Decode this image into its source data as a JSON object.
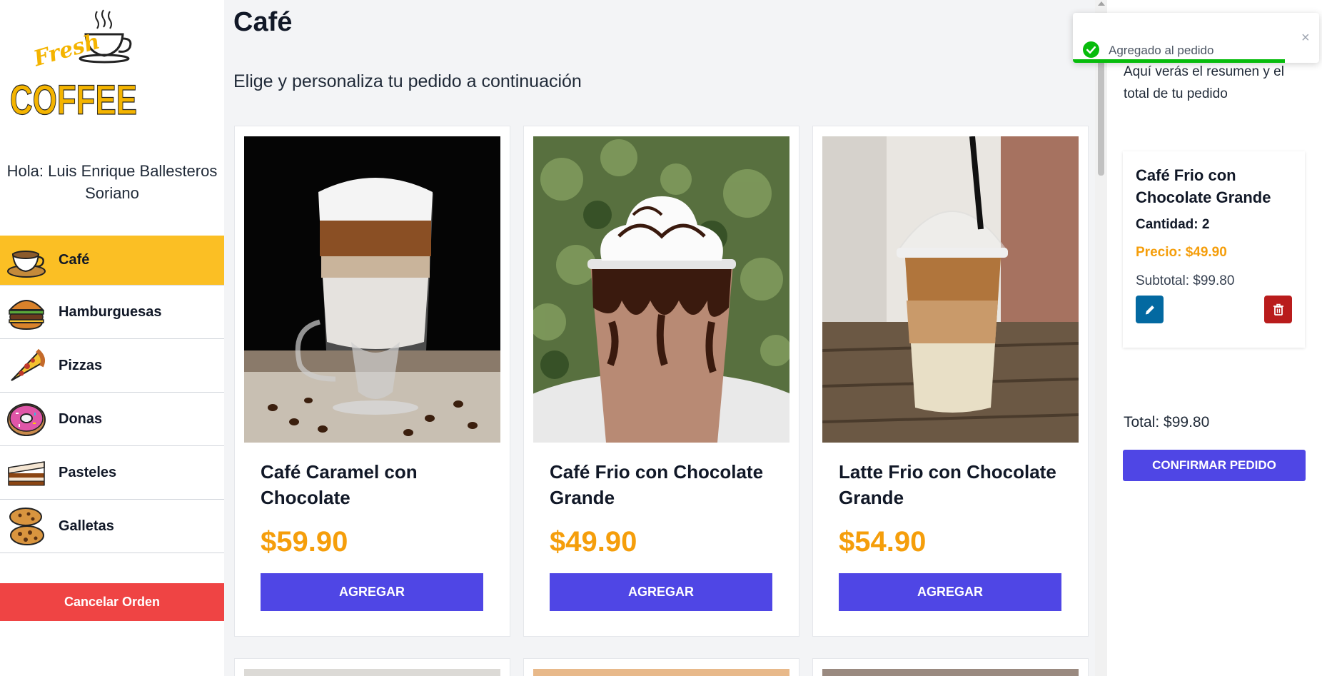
{
  "sidebar": {
    "logo_text": {
      "fresh": "Fresh",
      "coffee": "COFFEE"
    },
    "greeting": "Hola: Luis Enrique Ballesteros Soriano",
    "categories": [
      {
        "label": "Café",
        "icon": "coffee-cup-icon",
        "active": true
      },
      {
        "label": "Hamburguesas",
        "icon": "burger-icon",
        "active": false
      },
      {
        "label": "Pizzas",
        "icon": "pizza-icon",
        "active": false
      },
      {
        "label": "Donas",
        "icon": "donut-icon",
        "active": false
      },
      {
        "label": "Pasteles",
        "icon": "cake-icon",
        "active": false
      },
      {
        "label": "Galletas",
        "icon": "cookies-icon",
        "active": false
      }
    ],
    "cancel_label": "Cancelar Orden"
  },
  "main": {
    "title": "Café",
    "subtitle": "Elige y personaliza tu pedido a continuación",
    "products": [
      {
        "name": "Café Caramel con Chocolate",
        "price": "$59.90",
        "button": "AGREGAR",
        "image": "layered-latte-glass"
      },
      {
        "name": "Café Frio con Chocolate Grande",
        "price": "$49.90",
        "button": "AGREGAR",
        "image": "chocolate-frappe"
      },
      {
        "name": "Latte Frio con Chocolate Grande",
        "price": "$54.90",
        "button": "AGREGAR",
        "image": "iced-latte-cup"
      }
    ]
  },
  "summary": {
    "intro": "Aquí verás el resumen y el total de tu pedido",
    "items": [
      {
        "name": "Café Frio con Chocolate Grande",
        "qty_label": "Cantidad: ",
        "qty": "2",
        "price": "Precio: $49.90",
        "subtotal": "Subtotal: $99.80"
      }
    ],
    "total": "Total: $99.80",
    "confirm_label": "CONFIRMAR PEDIDO"
  },
  "toast": {
    "message": "Agregado al pedido",
    "close": "×",
    "progress": 0.86
  },
  "colors": {
    "accent_yellow": "#fbbf24",
    "primary": "#4f46e5",
    "price": "#f59e0b",
    "danger": "#ef4444",
    "edit": "#0369a1",
    "delete": "#b91c1c",
    "success": "#07bc0c"
  }
}
